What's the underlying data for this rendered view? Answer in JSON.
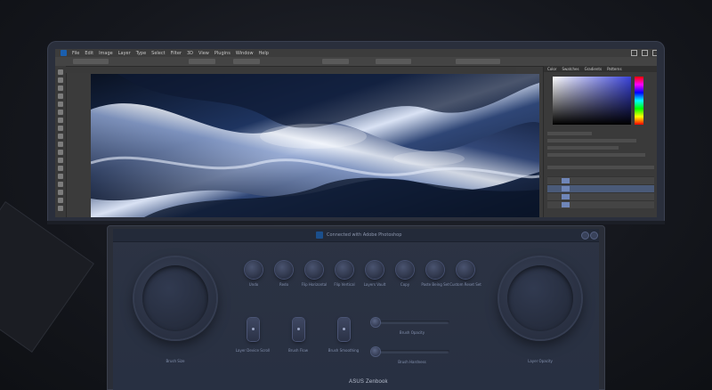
{
  "photoshop": {
    "menu_items": [
      "File",
      "Edit",
      "Image",
      "Layer",
      "Type",
      "Select",
      "Filter",
      "3D",
      "View",
      "Plugins",
      "Window",
      "Help"
    ],
    "panel_tabs": [
      "Color",
      "Swatches",
      "Gradients",
      "Patterns"
    ],
    "layers": [
      "",
      "",
      "",
      ""
    ]
  },
  "deck": {
    "title": "Connected with Adobe Photoshop",
    "dials": {
      "left_label": "Brush Size",
      "right_label": "Layer Opacity"
    },
    "knobs": [
      {
        "label": "Undo"
      },
      {
        "label": "Redo"
      },
      {
        "label": "Flip Horizontal"
      },
      {
        "label": "Flip Vertical"
      },
      {
        "label": "Layers Vault"
      },
      {
        "label": "Copy"
      },
      {
        "label": "Paste Being Set"
      },
      {
        "label": "Custom Reset Set"
      }
    ],
    "rockers": [
      {
        "label": "Layer Device Scroll"
      },
      {
        "label": "Brush Flow"
      },
      {
        "label": "Brush Smoothing"
      }
    ],
    "sliders": [
      {
        "label": "Brush Opacity",
        "value": 0.0
      },
      {
        "label": "Brush Hardness",
        "value": 0.0
      }
    ]
  },
  "brand": "ASUS Zenbook",
  "colors": {
    "accent": "#1b5fae",
    "deck_bg": "#283042",
    "label": "#8390ad"
  }
}
